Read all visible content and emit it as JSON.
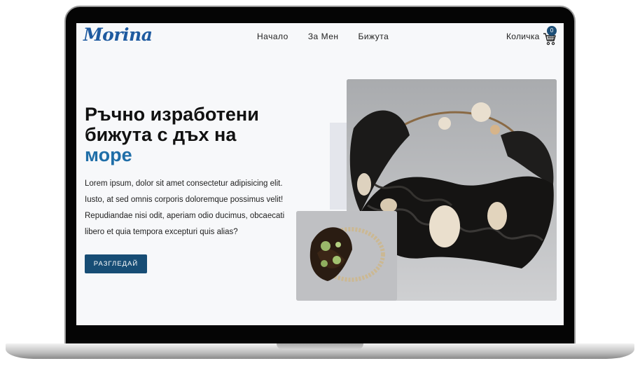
{
  "header": {
    "logo": "Morina",
    "nav": [
      "Начало",
      "За Мен",
      "Бижута"
    ],
    "cart_label": "Количка",
    "cart_count": "0"
  },
  "hero": {
    "title_line1": "Ръчно изработени",
    "title_line2": "бижута с дъх на",
    "title_accent": "море",
    "description": "Lorem ipsum, dolor sit amet consectetur adipisicing elit. Iusto, at sed omnis corporis doloremque possimus velit! Repudiandae nisi odit, aperiam odio ducimus, obcaecati libero et quia tempora excepturi quis alias?",
    "cta_label": "РАЗГЛЕДАЙ"
  },
  "images": {
    "main": "bracelet-black-ruffles-photo",
    "secondary": "bracelet-brown-green-photo"
  },
  "colors": {
    "brand": "#1e5aa0",
    "accent": "#1f6ea8",
    "button": "#174d75",
    "screen_bg": "#f7f8fa"
  },
  "icons": [
    "cart-icon"
  ]
}
